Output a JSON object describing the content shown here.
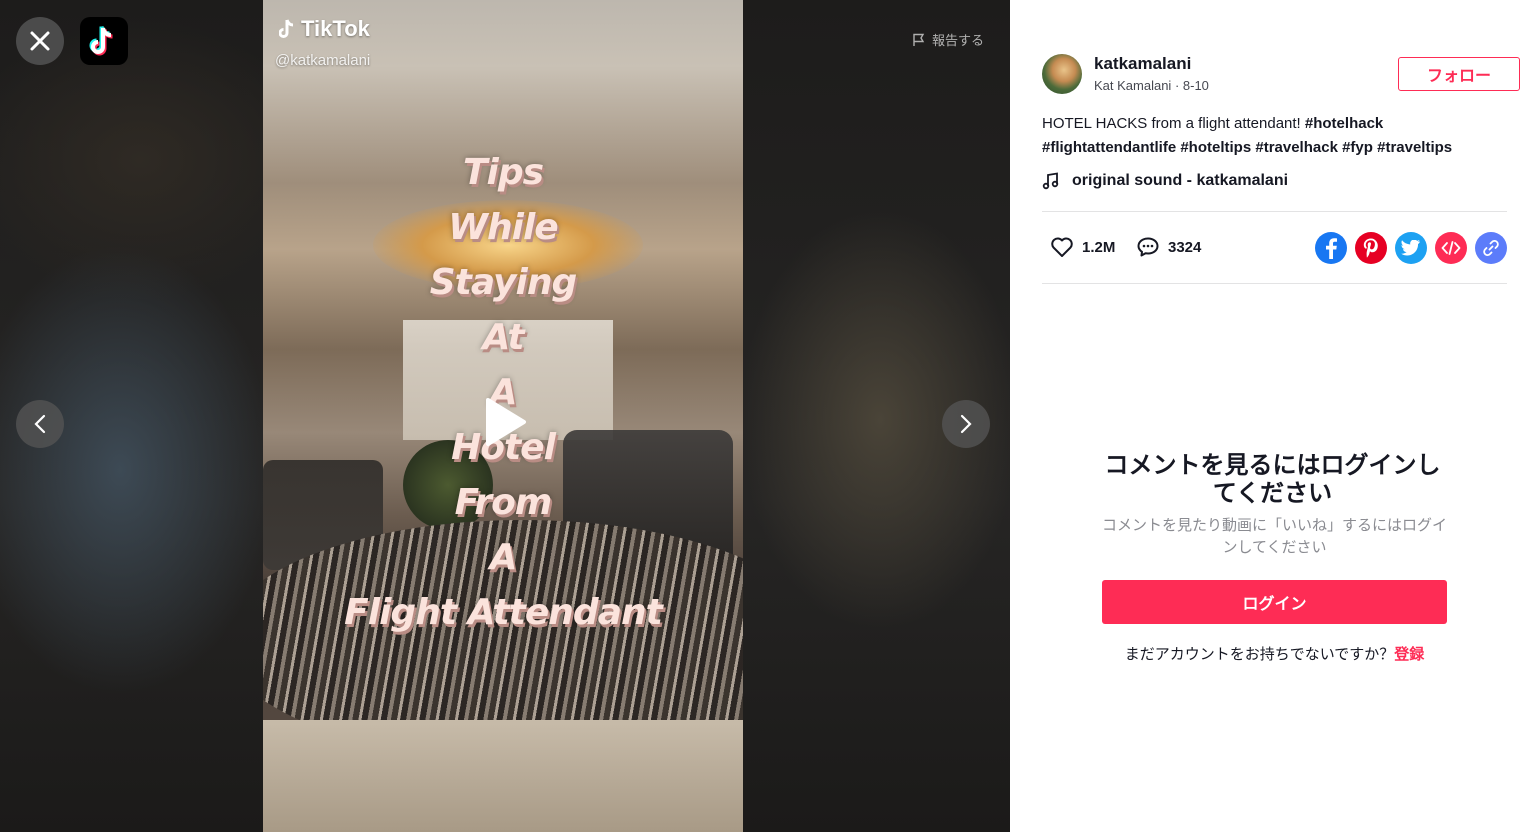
{
  "viewer": {
    "report_label": "報告する",
    "video": {
      "brand": "TikTok",
      "handle": "@katkamalani",
      "overlay_lines": [
        "Tips",
        "While",
        "Staying",
        "At",
        "A",
        "Hotel",
        "From",
        "A",
        "Flight Attendant"
      ]
    }
  },
  "post": {
    "username": "katkamalani",
    "display_name": "Kat Kamalani",
    "separator": " · ",
    "date": "8-10",
    "follow_label": "フォロー",
    "caption_text": "HOTEL HACKS from a flight attendant! ",
    "hashtags": [
      "#hotelhack",
      "#flightattendantlife",
      "#hoteltips",
      "#travelhack",
      "#fyp",
      "#traveltips"
    ],
    "music": "original sound - katkamalani",
    "likes": "1.2M",
    "comments": "3324"
  },
  "share": {
    "icons": [
      "facebook-icon",
      "pinterest-icon",
      "twitter-icon",
      "embed-icon",
      "link-icon"
    ],
    "colors": {
      "facebook": "#1877f2",
      "pinterest": "#e60023",
      "twitter": "#1da1f2",
      "embed": "#fe2c55",
      "link": "#5c7cfa"
    }
  },
  "login": {
    "title": "コメントを見るにはログインしてください",
    "subtitle": "コメントを見たり動画に「いいね」するにはログインしてください",
    "button_label": "ログイン",
    "signup_prompt": "まだアカウントをお持ちでないですか？",
    "signup_link": "登録"
  },
  "colors": {
    "accent": "#fe2c55",
    "text": "#161823"
  }
}
